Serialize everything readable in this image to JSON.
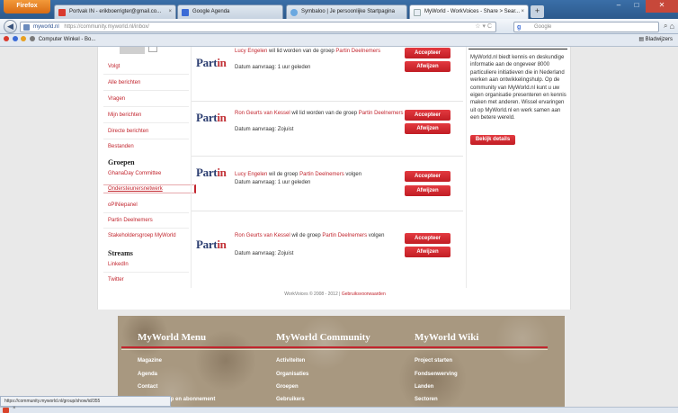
{
  "browser": {
    "app_button": "Firefox",
    "tabs": [
      {
        "label": "Portvak IN - erikboerrigter@gmail.co...",
        "active": false
      },
      {
        "label": "Google Agenda",
        "active": false
      },
      {
        "label": "Symbaloo | Je persoonlijke Startpagina",
        "active": false
      },
      {
        "label": "MyWorld - WorkVoices - Share > Sear...",
        "active": true
      }
    ],
    "new_tab": "+",
    "url_domain": "myworld.nl",
    "url_rest": "https://community.myworld.nl/inbox/",
    "search_placeholder": "Google",
    "search_engine_letter": "g",
    "bookmark_left": "Computer Winkel - Bo...",
    "bookmark_right": "Bladwijzers"
  },
  "sidebar": {
    "links": [
      "Volgt",
      "Alle berichten",
      "Vragen",
      "Mijn berichten",
      "Directe berichten",
      "Bestanden"
    ],
    "groups_heading": "Groepen",
    "groups": [
      "GhanaDay Committee",
      "Ondersteunersnetwerk",
      "oPINiepanel",
      "Partin Deelnemers",
      "Stakeholdersgroep MyWorld"
    ],
    "active_group_index": 1,
    "streams_heading": "Streams",
    "streams": [
      "LinkedIn",
      "Twitter"
    ]
  },
  "requests": [
    {
      "logo": "Partin",
      "user": "Lucy Engelen",
      "action": " wil lid worden van de groep ",
      "group": "Partin Deelnemers",
      "suffix": "",
      "date": "Datum aanvraag: 1 uur geleden",
      "accept": "Accepteer",
      "reject": "Afwijzen"
    },
    {
      "logo": "Partin",
      "user": "Ron Geurts van Kessel",
      "action": " wil lid worden van de groep ",
      "group": "Partin Deelnemers",
      "suffix": "",
      "date": "Datum aanvraag: Zojuist",
      "accept": "Accepteer",
      "reject": "Afwijzen"
    },
    {
      "logo": "Partin",
      "user": "Lucy Engelen",
      "action": " wil de groep ",
      "group": "Partin Deelnemers",
      "suffix": " volgen",
      "date": "Datum aanvraag: 1 uur geleden",
      "accept": "Accepteer",
      "reject": "Afwijzen"
    },
    {
      "logo": "Partin",
      "user": "Ron Geurts van Kessel",
      "action": " wil de groep ",
      "group": "Partin Deelnemers",
      "suffix": " volgen",
      "date": "Datum aanvraag: Zojuist",
      "accept": "Accepteer",
      "reject": "Afwijzen"
    }
  ],
  "right_panel": {
    "description": "MyWorld.nl biedt kennis en deskundige informatie aan de ongeveer 8000 particuliere initiatieven die in Nederland werken aan ontwikkelingshulp. Op de community van MyWorld.nl kunt u uw eigen organisatie presenteren en kennis maken met anderen. Wissel ervaringen uit op MyWorld.nl en werk samen aan een betere wereld.",
    "details_button": "Bekijk details"
  },
  "copyright": {
    "text": "WorkVoices © 2008 - 2012 | ",
    "link": "Gebruiksvoorwaarden"
  },
  "footer": {
    "columns": [
      {
        "heading": "MyWorld Menu",
        "items": [
          "Magazine",
          "Agenda",
          "Contact",
          "Lidmaatschap en abonnement"
        ]
      },
      {
        "heading": "MyWorld Community",
        "items": [
          "Activiteiten",
          "Organisaties",
          "Groepen",
          "Gebruikers"
        ]
      },
      {
        "heading": "MyWorld Wiki",
        "items": [
          "Project starten",
          "Fondsenwerving",
          "Landen",
          "Sectoren"
        ]
      }
    ]
  },
  "status_bar": "https://community.myworld.nl/group/show/id/355"
}
